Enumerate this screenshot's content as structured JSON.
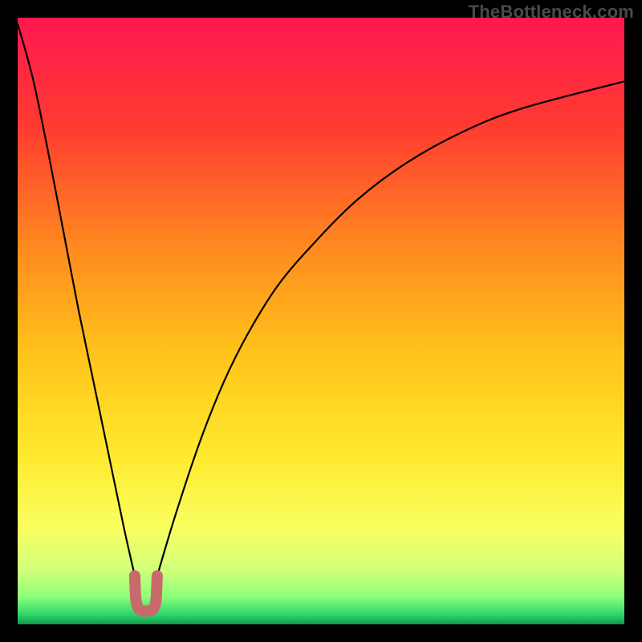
{
  "watermark": "TheBottleneck.com",
  "chart_data": {
    "type": "line",
    "title": "",
    "xlabel": "",
    "ylabel": "",
    "xlim": [
      0,
      100
    ],
    "ylim": [
      0,
      100
    ],
    "grid": false,
    "series": [
      {
        "name": "left-curve",
        "x": [
          0.0,
          2.5,
          5.0,
          7.5,
          10.0,
          12.5,
          15.0,
          17.5,
          19.3
        ],
        "values": [
          99.0,
          90.0,
          78.0,
          65.0,
          52.0,
          40.0,
          28.0,
          16.0,
          8.0
        ]
      },
      {
        "name": "right-curve",
        "x": [
          23.0,
          26.0,
          30.0,
          34.0,
          38.0,
          43.0,
          49.0,
          56.0,
          64.0,
          73.0,
          83.0,
          100.0
        ],
        "values": [
          8.0,
          18.0,
          30.0,
          40.0,
          48.0,
          56.0,
          63.0,
          70.0,
          76.0,
          81.0,
          85.0,
          89.5
        ]
      },
      {
        "name": "u-marker",
        "x": [
          19.3,
          19.5,
          20.0,
          20.8,
          21.5,
          22.3,
          22.8,
          23.0
        ],
        "values": [
          8.0,
          4.0,
          2.5,
          2.2,
          2.2,
          2.5,
          4.0,
          8.0
        ]
      }
    ],
    "background_gradient": {
      "stops": [
        {
          "pos": 0.0,
          "color": "#ff1850"
        },
        {
          "pos": 0.18,
          "color": "#ff3b30"
        },
        {
          "pos": 0.38,
          "color": "#ff8a1f"
        },
        {
          "pos": 0.55,
          "color": "#ffc21a"
        },
        {
          "pos": 0.72,
          "color": "#ffe92e"
        },
        {
          "pos": 0.84,
          "color": "#faff60"
        },
        {
          "pos": 0.91,
          "color": "#d2ff7a"
        },
        {
          "pos": 0.955,
          "color": "#8cff7a"
        },
        {
          "pos": 0.985,
          "color": "#2bd36a"
        },
        {
          "pos": 1.0,
          "color": "#0e9a4a"
        }
      ]
    },
    "colors": {
      "curve": "#000000",
      "u_marker": "#c96a6a"
    }
  }
}
